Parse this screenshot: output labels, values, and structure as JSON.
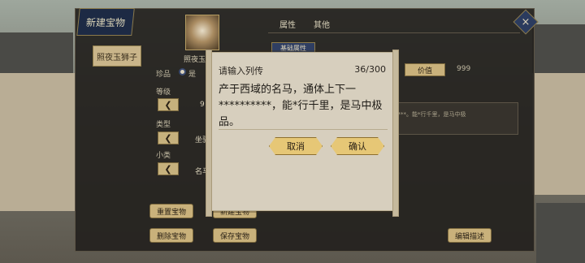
{
  "panel": {
    "title": "新建宝物",
    "close_icon": "×"
  },
  "left": {
    "side_tab": "照夜玉狮子",
    "portrait_name": "照夜玉狮",
    "rarity_label": "珍品",
    "rarity_value": "是",
    "level_label": "等级",
    "level_value": "9",
    "type_label": "类型",
    "type_value": "坐骑",
    "subtype_label": "小类",
    "subtype_value": "名马",
    "buttons": {
      "reset": "重置宝物",
      "new": "新建宝物",
      "delete": "删除宝物",
      "save": "保存宝物"
    }
  },
  "right": {
    "tab_attr": "属性",
    "tab_other": "其他",
    "section": "基础属性",
    "value_label": "价值",
    "value_num": "999",
    "desc_preview": "****。能*行千里，是马中极",
    "edit_desc": "编辑描述"
  },
  "popup": {
    "title": "请输入列传",
    "count": "36/300",
    "text": "产于西域的名马，通体上下一**********，能*行千里，是马中极品。",
    "cancel": "取消",
    "confirm": "确认"
  }
}
